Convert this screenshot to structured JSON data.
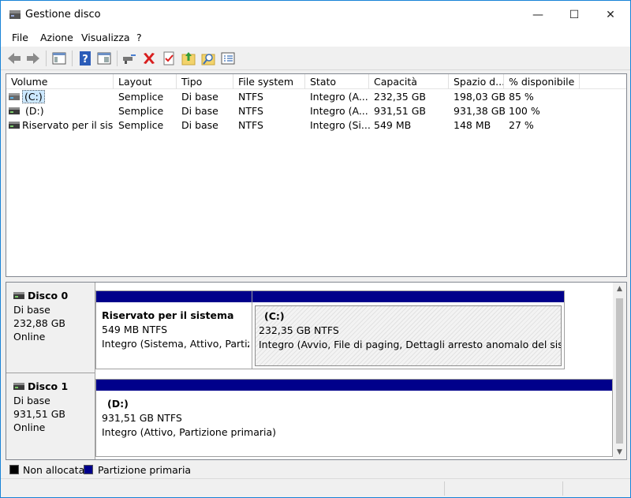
{
  "window": {
    "title": "Gestione disco",
    "controls": [
      "—",
      "☐",
      "✕"
    ]
  },
  "menu": [
    "File",
    "Azione",
    "Visualizza",
    "?"
  ],
  "toolbar": [
    "back-icon",
    "forward-icon",
    "console-tree-icon",
    "help-icon",
    "properties-icon",
    "connect-icon",
    "delete-icon",
    "check-icon",
    "import-icon",
    "search-icon",
    "list-icon"
  ],
  "columns": [
    "Volume",
    "Layout",
    "Tipo",
    "File system",
    "Stato",
    "Capacità",
    "Spazio d...",
    "% disponibile"
  ],
  "volumes": [
    [
      "(C:)",
      "Semplice",
      "Di base",
      "NTFS",
      "Integro (A...",
      "232,35 GB",
      "198,03 GB",
      "85 %"
    ],
    [
      "(D:)",
      "Semplice",
      "Di base",
      "NTFS",
      "Integro (A...",
      "931,51 GB",
      "931,38 GB",
      "100 %"
    ],
    [
      "Riservato per il sis...",
      "Semplice",
      "Di base",
      "NTFS",
      "Integro (Si...",
      "549 MB",
      "148 MB",
      "27 %"
    ]
  ],
  "disks": [
    {
      "name": "Disco 0",
      "type": "Di base",
      "size": "232,88 GB",
      "status": "Online",
      "partitions": [
        {
          "name": "Riservato per il sistema",
          "size": "549 MB NTFS",
          "status": "Integro (Sistema, Attivo, Partizione primaria)"
        },
        {
          "name": "(C:)",
          "size": "232,35 GB NTFS",
          "status": "Integro (Avvio, File di paging, Dettagli arresto anomalo del sistema, Partizione primaria)"
        }
      ]
    },
    {
      "name": "Disco 1",
      "type": "Di base",
      "size": "931,51 GB",
      "status": "Online",
      "partitions": [
        {
          "name": "(D:)",
          "size": "931,51 GB NTFS",
          "status": "Integro (Attivo, Partizione primaria)"
        }
      ]
    }
  ],
  "legend": [
    {
      "label": "Non allocata",
      "color": "#000000"
    },
    {
      "label": "Partizione primaria",
      "color": "#00008b"
    }
  ]
}
